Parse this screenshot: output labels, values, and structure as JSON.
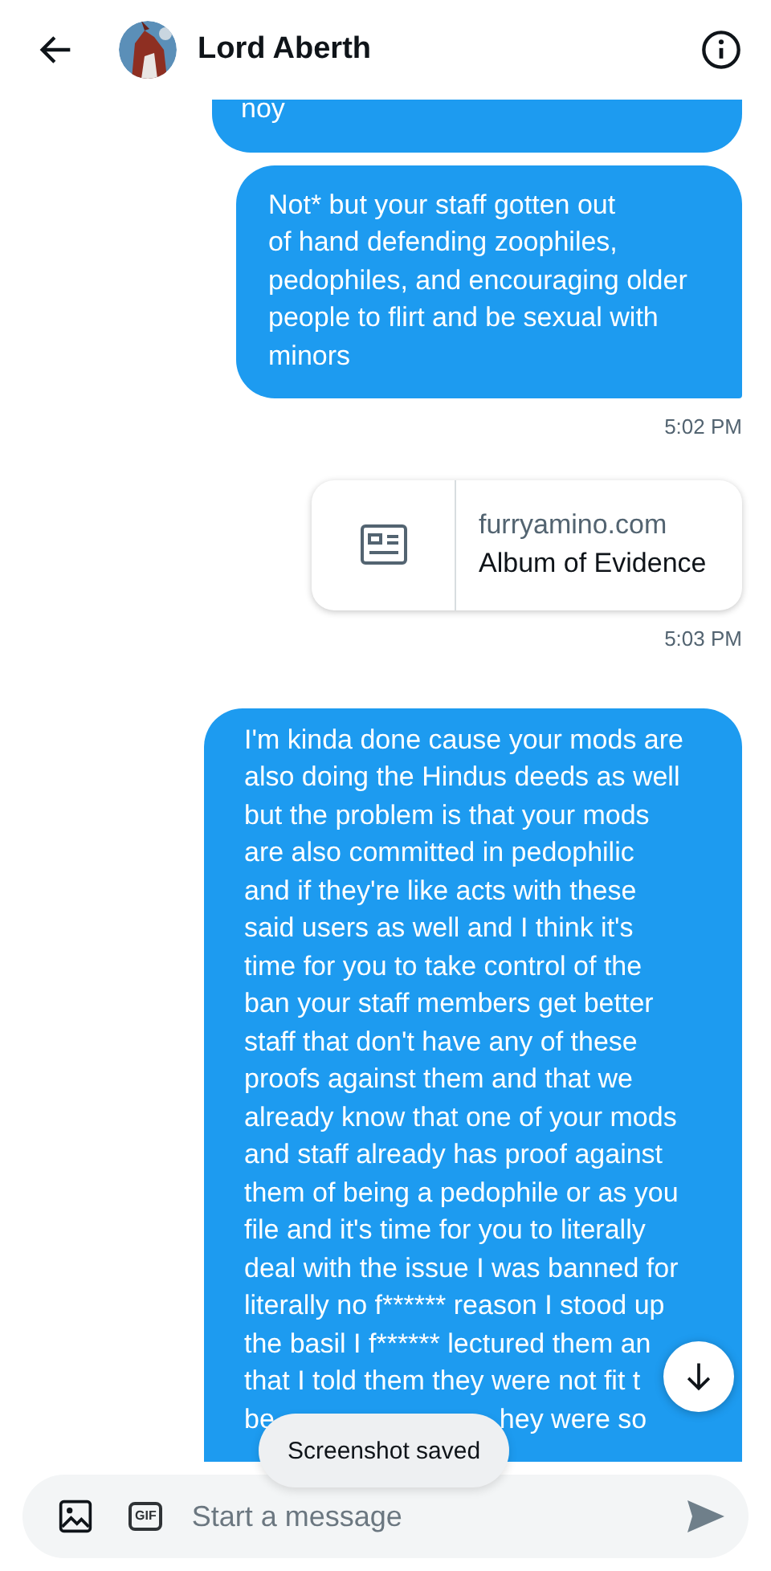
{
  "header": {
    "title": "Lord Aberth"
  },
  "messages": [
    {
      "kind": "text",
      "lines": [
        "noy"
      ]
    },
    {
      "kind": "text",
      "lines": [
        "Not* but your staff gotten out",
        "of hand defending zoophiles,",
        "pedophiles, and encouraging older",
        "people to flirt and be sexual with",
        "minors"
      ],
      "time": "5:02 PM"
    },
    {
      "kind": "link",
      "domain": "furryamino.com",
      "title": "Album of Evidence",
      "time": "5:03 PM"
    },
    {
      "kind": "text",
      "lines": [
        "I'm kinda done cause your mods are",
        "also doing the Hindus deeds as well",
        "but the problem is that your mods",
        "are also committed in pedophilic",
        "and if they're like acts with these",
        "said users as well and I think it's",
        "time for you to take control of the",
        "ban your staff members get better",
        "staff that don't have any of these",
        "proofs against them and that we",
        "already know that one of your mods",
        "and staff already has proof against",
        "them of being a pedophile or as you",
        "file and it's time for you to literally",
        "deal with the issue I was banned for",
        "literally no f****** reason I stood up",
        "the basil I f****** lectured them an",
        "that I told them they were not fit t"
      ],
      "partial_line": [
        "be",
        "hey were so"
      ]
    }
  ],
  "toast": "Screenshot saved",
  "composer": {
    "gif_label": "GIF",
    "placeholder": "Start a message"
  }
}
